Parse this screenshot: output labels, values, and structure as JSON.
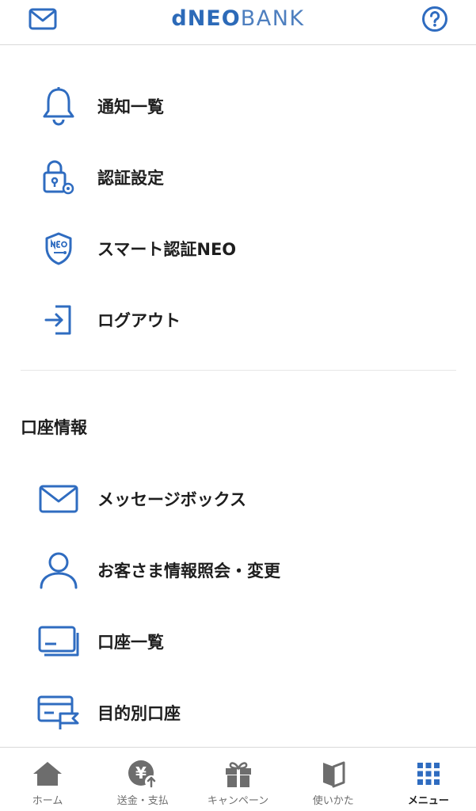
{
  "header": {
    "logo": {
      "d": "d",
      "neo": "NEO",
      "bank": "BANK"
    }
  },
  "menu_top": [
    {
      "label": "通知一覧",
      "icon": "bell-icon"
    },
    {
      "label": "認証設定",
      "icon": "lock-gear-icon"
    },
    {
      "label": "スマート認証NEO",
      "icon": "neo-shield-icon"
    },
    {
      "label": "ログアウト",
      "icon": "logout-icon"
    }
  ],
  "section": {
    "title": "口座情報"
  },
  "menu_account": [
    {
      "label": "メッセージボックス",
      "icon": "envelope-icon"
    },
    {
      "label": "お客さま情報照会・変更",
      "icon": "person-icon"
    },
    {
      "label": "口座一覧",
      "icon": "cards-icon"
    },
    {
      "label": "目的別口座",
      "icon": "card-flag-icon"
    }
  ],
  "tabs": [
    {
      "label": "ホーム",
      "icon": "home-icon",
      "active": false
    },
    {
      "label": "送金・支払",
      "icon": "yen-icon",
      "active": false
    },
    {
      "label": "キャンペーン",
      "icon": "gift-icon",
      "active": false
    },
    {
      "label": "使いかた",
      "icon": "book-icon",
      "active": false
    },
    {
      "label": "メニュー",
      "icon": "grid-icon",
      "active": true
    }
  ],
  "colors": {
    "accent": "#2f6cc0",
    "tab_icon": "#6d6d6d",
    "divider": "#e6e6e6"
  }
}
